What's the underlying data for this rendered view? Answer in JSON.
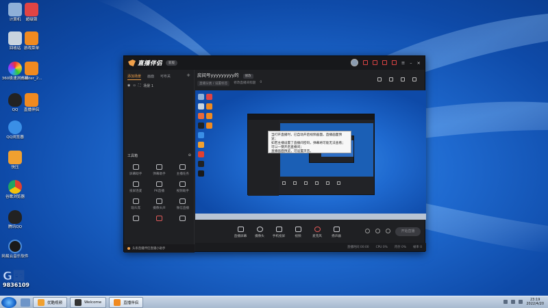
{
  "desktop": {
    "icons": [
      {
        "label": "计算机",
        "color": "#8fb0d8"
      },
      {
        "label": "回收站",
        "color": "#c9d4df"
      },
      {
        "label": "360极速浏览器",
        "color": "#e86a3a"
      },
      {
        "label": "QQ",
        "color": "#222222"
      },
      {
        "label": "QQ浏览器",
        "color": "#3a8fe6"
      },
      {
        "label": "快压",
        "color": "#f0a030"
      },
      {
        "label": "谷歌浏览器",
        "color": "#e04030"
      },
      {
        "label": "腾讯QQ",
        "color": "#222222"
      },
      {
        "label": "网易云音乐软件",
        "color": "#1a1a1a"
      },
      {
        "label": "超级锁",
        "color": "#e04444"
      },
      {
        "label": "游戏菜单",
        "color": "#f08a20"
      },
      {
        "label": "master_2...",
        "color": "#f08a20"
      },
      {
        "label": "直播伴侣",
        "color": "#f08a20"
      }
    ]
  },
  "app": {
    "title": "直播伴侣",
    "version": "新版",
    "left": {
      "tabs": [
        "添加场景",
        "画面",
        "可布关"
      ],
      "scene_name": "场景 1",
      "tools_label": "工具箱",
      "tools": [
        "屏幕助手",
        "弹幕助手",
        "主播任务",
        "投屏连麦",
        "PK直播",
        "视频助手",
        "观众席",
        "摄像头声",
        "微信直播",
        "",
        "",
        ""
      ],
      "notice": "头条直播伴侣直播小助手"
    },
    "room": {
      "name": "房间号yyyyyyyyy的",
      "edit": "修改",
      "category": "直播分类 / 设置标签",
      "title_hint": "修改直播间标题",
      "viewers": "0",
      "extra": "开通"
    },
    "popup": {
      "lines": [
        "当打开直播时，已自动开启视频画面，直播画面预览；",
        "如若主播设置了直播间密码，弹幕将可能无法查看；",
        "可以一键开启直播间；",
        "直播画面预览，可设置声音。"
      ]
    },
    "controls": [
      {
        "label": "直播屏幕"
      },
      {
        "label": "摄像头"
      },
      {
        "label": "手机投屏"
      },
      {
        "label": "视频"
      },
      {
        "label": "麦克风",
        "red": true
      },
      {
        "label": "扬声器"
      }
    ],
    "start_button": "开始直播",
    "status": [
      "直播时间 00:00",
      "CPU 0%",
      "内存 0%",
      "帧率 0"
    ]
  },
  "watermark": {
    "brand": "G国",
    "number": "9836109"
  },
  "taskbar": {
    "buttons": [
      {
        "label": "优酷视频",
        "color": "#f0a030"
      },
      {
        "label": "Welcome",
        "color": "#f0a030"
      },
      {
        "label": "直播伴侣",
        "color": "#f08a20"
      }
    ],
    "time": "23:19",
    "date": "2022/4/20"
  }
}
